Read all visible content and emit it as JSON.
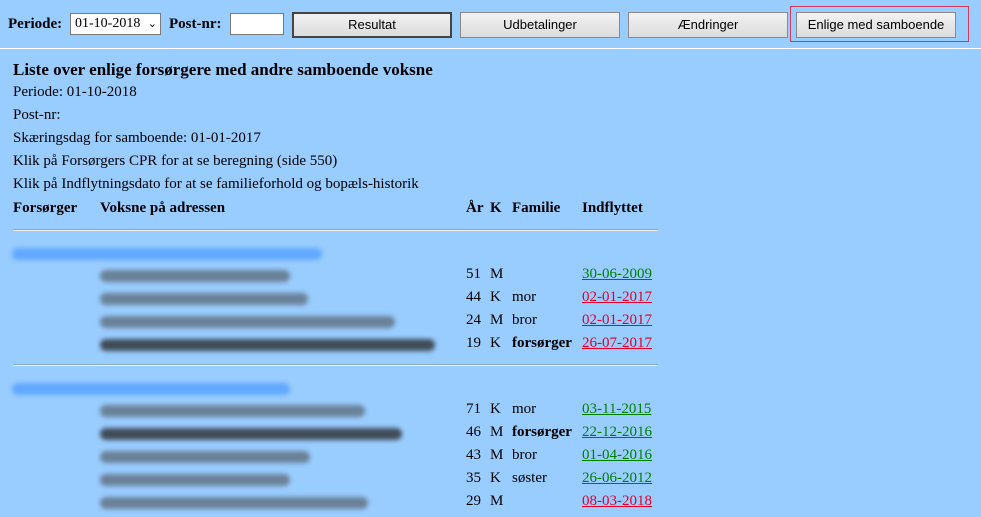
{
  "toolbar": {
    "periode_label": "Periode:",
    "periode_value": "01-10-2018",
    "postnr_label": "Post-nr:",
    "postnr_value": "",
    "buttons": {
      "resultat": "Resultat",
      "udbetalinger": "Udbetalinger",
      "aendringer": "Ændringer",
      "enlige": "Enlige med samboende"
    }
  },
  "report": {
    "title": "Liste over enlige forsørgere med andre samboende voksne",
    "periode_line": "Periode: 01-10-2018",
    "postnr_line": "Post-nr:",
    "skaeringsdag_line": "Skæringsdag for samboende: 01-01-2017",
    "hint_cpr": "Klik på Forsørgers CPR for at se beregning (side 550)",
    "hint_indflytning": "Klik på Indflytningsdato for at se familieforhold og bopæls-historik"
  },
  "table": {
    "headers": {
      "forsorger": "Forsørger",
      "voksne": "Voksne på adressen",
      "aar": "År",
      "k": "K",
      "familie": "Familie",
      "indflyttet": "Indflyttet"
    },
    "groups": [
      {
        "rows": [
          {
            "age": "51",
            "k": "M",
            "familie": "",
            "date": "30-06-2009",
            "date_color": "green",
            "is_provider": false
          },
          {
            "age": "44",
            "k": "K",
            "familie": "mor",
            "date": "02-01-2017",
            "date_color": "red",
            "is_provider": false
          },
          {
            "age": "24",
            "k": "M",
            "familie": "bror",
            "date": "02-01-2017",
            "date_color": "red",
            "is_provider": false
          },
          {
            "age": "19",
            "k": "K",
            "familie": "forsørger",
            "date": "26-07-2017",
            "date_color": "red",
            "is_provider": true
          }
        ]
      },
      {
        "rows": [
          {
            "age": "71",
            "k": "K",
            "familie": "mor",
            "date": "03-11-2015",
            "date_color": "green",
            "is_provider": false
          },
          {
            "age": "46",
            "k": "M",
            "familie": "forsørger",
            "date": "22-12-2016",
            "date_color": "green",
            "is_provider": true
          },
          {
            "age": "43",
            "k": "M",
            "familie": "bror",
            "date": "01-04-2016",
            "date_color": "green",
            "is_provider": false
          },
          {
            "age": "35",
            "k": "K",
            "familie": "søster",
            "date": "26-06-2012",
            "date_color": "green",
            "is_provider": false
          },
          {
            "age": "29",
            "k": "M",
            "familie": "",
            "date": "08-03-2018",
            "date_color": "red",
            "is_provider": false
          }
        ]
      }
    ]
  }
}
